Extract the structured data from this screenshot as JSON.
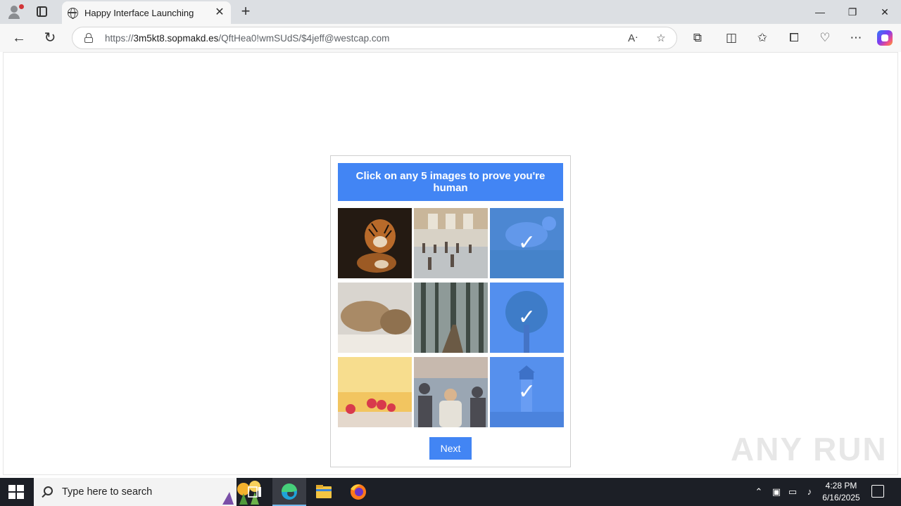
{
  "browser": {
    "tab_title": "Happy Interface Launching",
    "close_tab_glyph": "✕",
    "new_tab_glyph": "+",
    "window_controls": {
      "minimize": "—",
      "restore": "❐",
      "close": "✕"
    },
    "nav": {
      "back": "←",
      "refresh": "↻"
    },
    "address": {
      "scheme": "https://",
      "host": "3m5kt8.sopmakd.es",
      "path": "/QftHea0!wmSUdS/$4jeff@westcap.com"
    },
    "omnibox_icons": [
      "read-aloud-icon",
      "favorite-star-icon"
    ],
    "toolbar_icons": [
      "extensions-icon",
      "split-screen-icon",
      "favorites-icon",
      "collections-icon",
      "browser-essentials-icon",
      "more-icon",
      "copilot-icon"
    ]
  },
  "captcha": {
    "instruction": "Click on any 5 images to prove you're human",
    "check_glyph": "✓",
    "next_label": "Next",
    "images": [
      {
        "subject": "tiger",
        "selected": false
      },
      {
        "subject": "crowded-hall",
        "selected": false
      },
      {
        "subject": "sheep-grazing",
        "selected": true
      },
      {
        "subject": "walruses",
        "selected": false
      },
      {
        "subject": "misty-forest",
        "selected": false
      },
      {
        "subject": "tree",
        "selected": true
      },
      {
        "subject": "raspberries",
        "selected": false
      },
      {
        "subject": "street-crowd",
        "selected": false
      },
      {
        "subject": "lighthouse",
        "selected": true
      }
    ]
  },
  "watermark": "ANY RUN",
  "taskbar": {
    "search_placeholder": "Type here to search",
    "apps": [
      "task-view",
      "edge",
      "file-explorer",
      "firefox"
    ],
    "time": "4:28 PM",
    "date": "6/16/2025"
  }
}
